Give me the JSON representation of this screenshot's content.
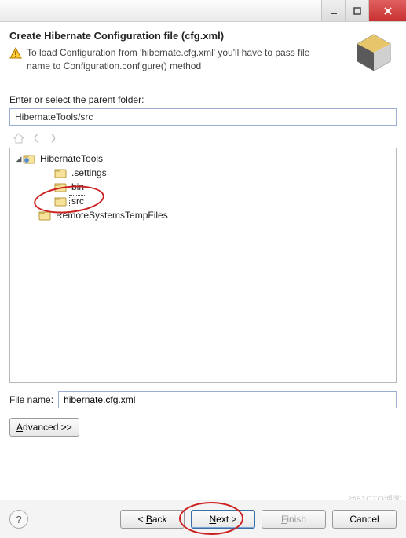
{
  "header": {
    "title": "Create Hibernate Configuration file (cfg.xml)",
    "warning": "To load Configuration from 'hibernate.cfg.xml' you'll have to pass file name to Configuration.configure() method"
  },
  "body": {
    "parent_folder_label": "Enter or select the parent folder:",
    "parent_folder_value": "HibernateTools/src",
    "tree": {
      "root": "HibernateTools",
      "children": [
        ".settings",
        "bin",
        "src"
      ],
      "selected": "src",
      "sibling_root": "RemoteSystemsTempFiles"
    },
    "file_name_label_pre": "File na",
    "file_name_label_ul": "m",
    "file_name_label_post": "e:",
    "file_name_value": "hibernate.cfg.xml",
    "advanced_ul": "A",
    "advanced_rest": "dvanced >>"
  },
  "footer": {
    "help": "?",
    "back_pre": "< ",
    "back_ul": "B",
    "back_post": "ack",
    "next_ul": "N",
    "next_post": "ext >",
    "finish_ul": "F",
    "finish_post": "inish",
    "cancel": "Cancel"
  },
  "watermark": "@51CTO博客"
}
